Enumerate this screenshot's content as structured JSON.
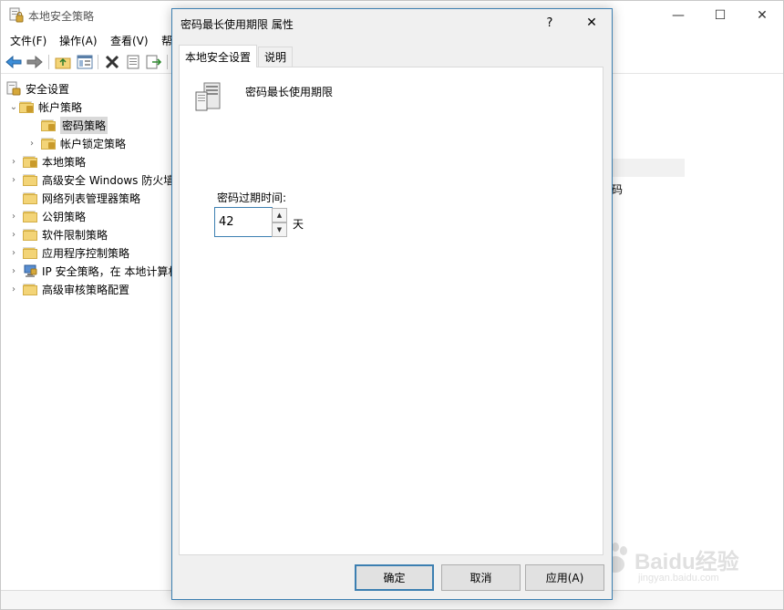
{
  "window": {
    "title": "本地安全策略",
    "minimize_glyph": "—",
    "maximize_glyph": "☐",
    "close_glyph": "✕"
  },
  "menu": {
    "items": [
      "文件(F)",
      "操作(A)",
      "查看(V)",
      "帮"
    ]
  },
  "toolbar": {
    "icons": [
      "back-arrow-icon",
      "forward-arrow-icon",
      "up-folder-icon",
      "show-hide-tree-icon",
      "delete-icon",
      "properties-icon",
      "export-icon"
    ]
  },
  "tree": {
    "items": [
      {
        "label": "安全设置",
        "icon": "security-settings-icon",
        "expanded": true
      },
      {
        "label": "帐户策略",
        "icon": "folder-icon",
        "expanded": true
      },
      {
        "label": "密码策略",
        "icon": "folder-icon",
        "selected": true
      },
      {
        "label": "帐户锁定策略",
        "icon": "folder-icon"
      },
      {
        "label": "本地策略",
        "icon": "folder-icon"
      },
      {
        "label": "高级安全 Windows 防火墙",
        "icon": "folder-icon"
      },
      {
        "label": "网络列表管理器策略",
        "icon": "folder-icon"
      },
      {
        "label": "公钥策略",
        "icon": "folder-icon"
      },
      {
        "label": "软件限制策略",
        "icon": "folder-icon"
      },
      {
        "label": "应用程序控制策略",
        "icon": "folder-icon"
      },
      {
        "label": "IP 安全策略，在 本地计算机",
        "icon": "ip-security-icon"
      },
      {
        "label": "高级审核策略配置",
        "icon": "folder-icon"
      }
    ]
  },
  "right_pane": {
    "partial_text": "码"
  },
  "dialog": {
    "title": "密码最长使用期限 属性",
    "help_glyph": "?",
    "close_glyph": "✕",
    "tabs": [
      {
        "label": "本地安全设置",
        "active": true
      },
      {
        "label": "说明",
        "active": false
      }
    ],
    "policy_name": "密码最长使用期限",
    "field_label": "密码过期时间:",
    "field_value": "42",
    "unit": "天",
    "buttons": {
      "ok": "确定",
      "cancel": "取消",
      "apply": "应用(A)"
    }
  },
  "watermark": {
    "text": "Baidu经验",
    "sub": "jingyan.baidu.com"
  },
  "colors": {
    "accent": "#3c7fb1",
    "folder": "#f3d477",
    "selection": "#d9d9d9"
  }
}
